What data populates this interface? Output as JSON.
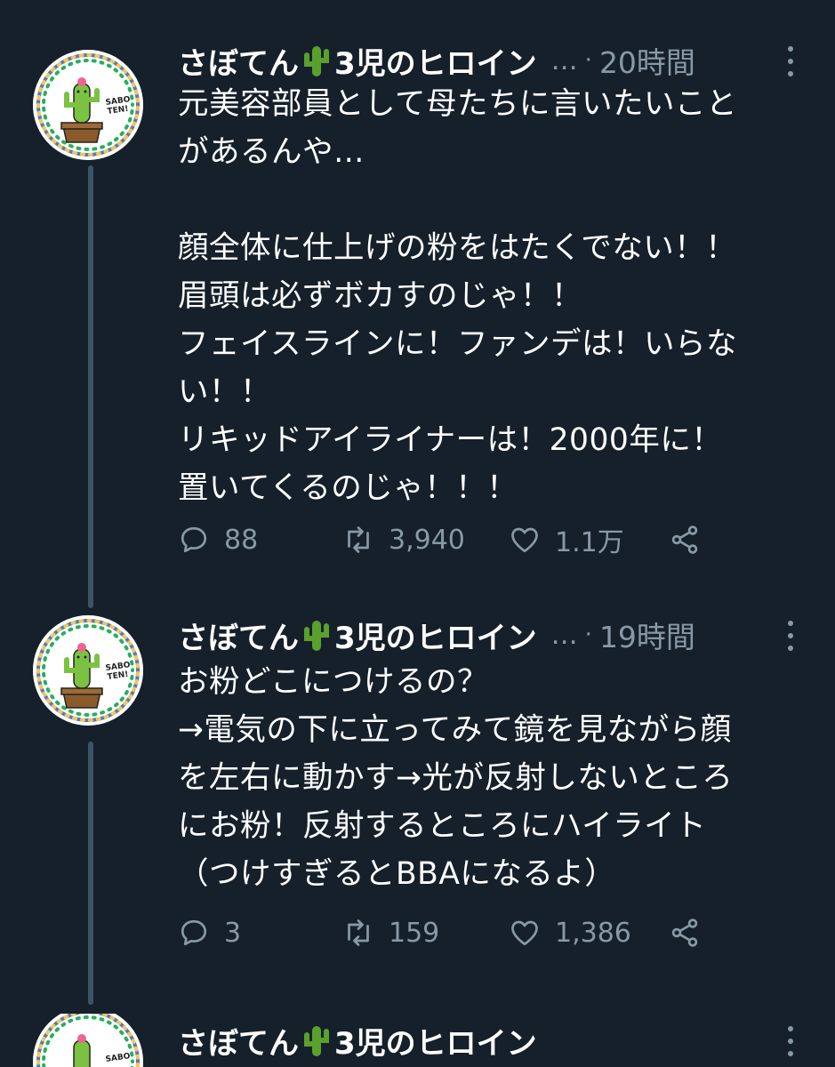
{
  "tweets": [
    {
      "name": "さぼてん",
      "name_suffix": "3児のヒロイン",
      "handle": "…",
      "separator": "·",
      "time": "20時間",
      "text": "元美容部員として母たちに言いたいこと\nがあるんや…\n\n顔全体に仕上げの粉をはたくでない！！\n眉頭は必ずボカすのじゃ！！\nフェイスラインに！ファンデは！いらな\nい！！\nリキッドアイライナーは！2000年に！\n置いてくるのじゃ！！！",
      "replies": "88",
      "retweets": "3,940",
      "likes": "1.1万"
    },
    {
      "name": "さぼてん",
      "name_suffix": "3児のヒロイン",
      "handle": "…",
      "separator": "·",
      "time": "19時間",
      "text": "お粉どこにつけるの？\n→電気の下に立ってみて鏡を見ながら顔\nを左右に動かす→光が反射しないところ\nにお粉！反射するところにハイライト\n（つけすぎるとBBAになるよ）",
      "replies": "3",
      "retweets": "159",
      "likes": "1,386"
    },
    {
      "name": "さぼてん",
      "name_suffix": "3児のヒロイン"
    }
  ],
  "avatar": {
    "logo_text_1": "SABO",
    "logo_text_2": "TEN!"
  },
  "colors": {
    "background": "#15202b",
    "secondary_text": "#8899a6",
    "thread_line": "#3d5466"
  }
}
